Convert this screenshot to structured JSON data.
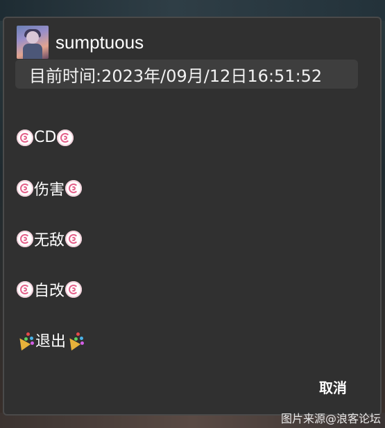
{
  "dialog": {
    "username": "sumptuous",
    "time_text": "目前时间:2023年/09月/12日16:51:52",
    "menu_items": [
      {
        "label": "CD",
        "icon": "fish-cake-swirl-icon"
      },
      {
        "label": "伤害",
        "icon": "fish-cake-swirl-icon"
      },
      {
        "label": "无敌",
        "icon": "fish-cake-swirl-icon"
      },
      {
        "label": "自改",
        "icon": "fish-cake-swirl-icon"
      },
      {
        "label": "退出",
        "icon": "party-popper-icon"
      }
    ],
    "cancel_label": "取消"
  },
  "watermark": "图片来源@浪客论坛",
  "colors": {
    "dialog_bg": "#303030",
    "time_bar_bg": "#3e3e3e",
    "text": "#ffffff"
  }
}
